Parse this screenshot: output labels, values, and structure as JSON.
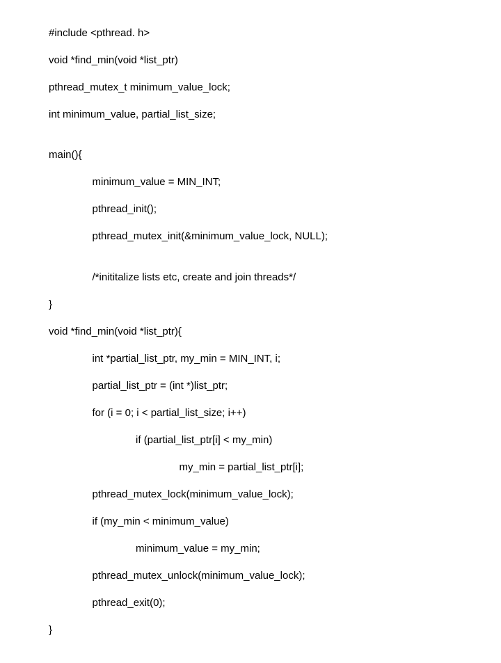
{
  "code": {
    "l1": "#include <pthread. h>",
    "l2": "void *find_min(void *list_ptr)",
    "l3": "pthread_mutex_t minimum_value_lock;",
    "l4": "int minimum_value, partial_list_size;",
    "l5": "",
    "l6": "main(){",
    "l7": "               minimum_value = MIN_INT;",
    "l8": "               pthread_init();",
    "l9": "               pthread_mutex_init(&minimum_value_lock, NULL);",
    "l10": "",
    "l11": "               /*inititalize lists etc, create and join threads*/",
    "l12": "}",
    "l13": "void *find_min(void *list_ptr){",
    "l14": "               int *partial_list_ptr, my_min = MIN_INT, i;",
    "l15": "               partial_list_ptr = (int *)list_ptr;",
    "l16": "               for (i = 0; i < partial_list_size; i++)",
    "l17": "                              if (partial_list_ptr[i] < my_min)",
    "l18": "                                             my_min = partial_list_ptr[i];",
    "l19": "               pthread_mutex_lock(minimum_value_lock);",
    "l20": "               if (my_min < minimum_value)",
    "l21": "                              minimum_value = my_min;",
    "l22": "               pthread_mutex_unlock(minimum_value_lock);",
    "l23": "               pthread_exit(0);",
    "l24": "}"
  }
}
